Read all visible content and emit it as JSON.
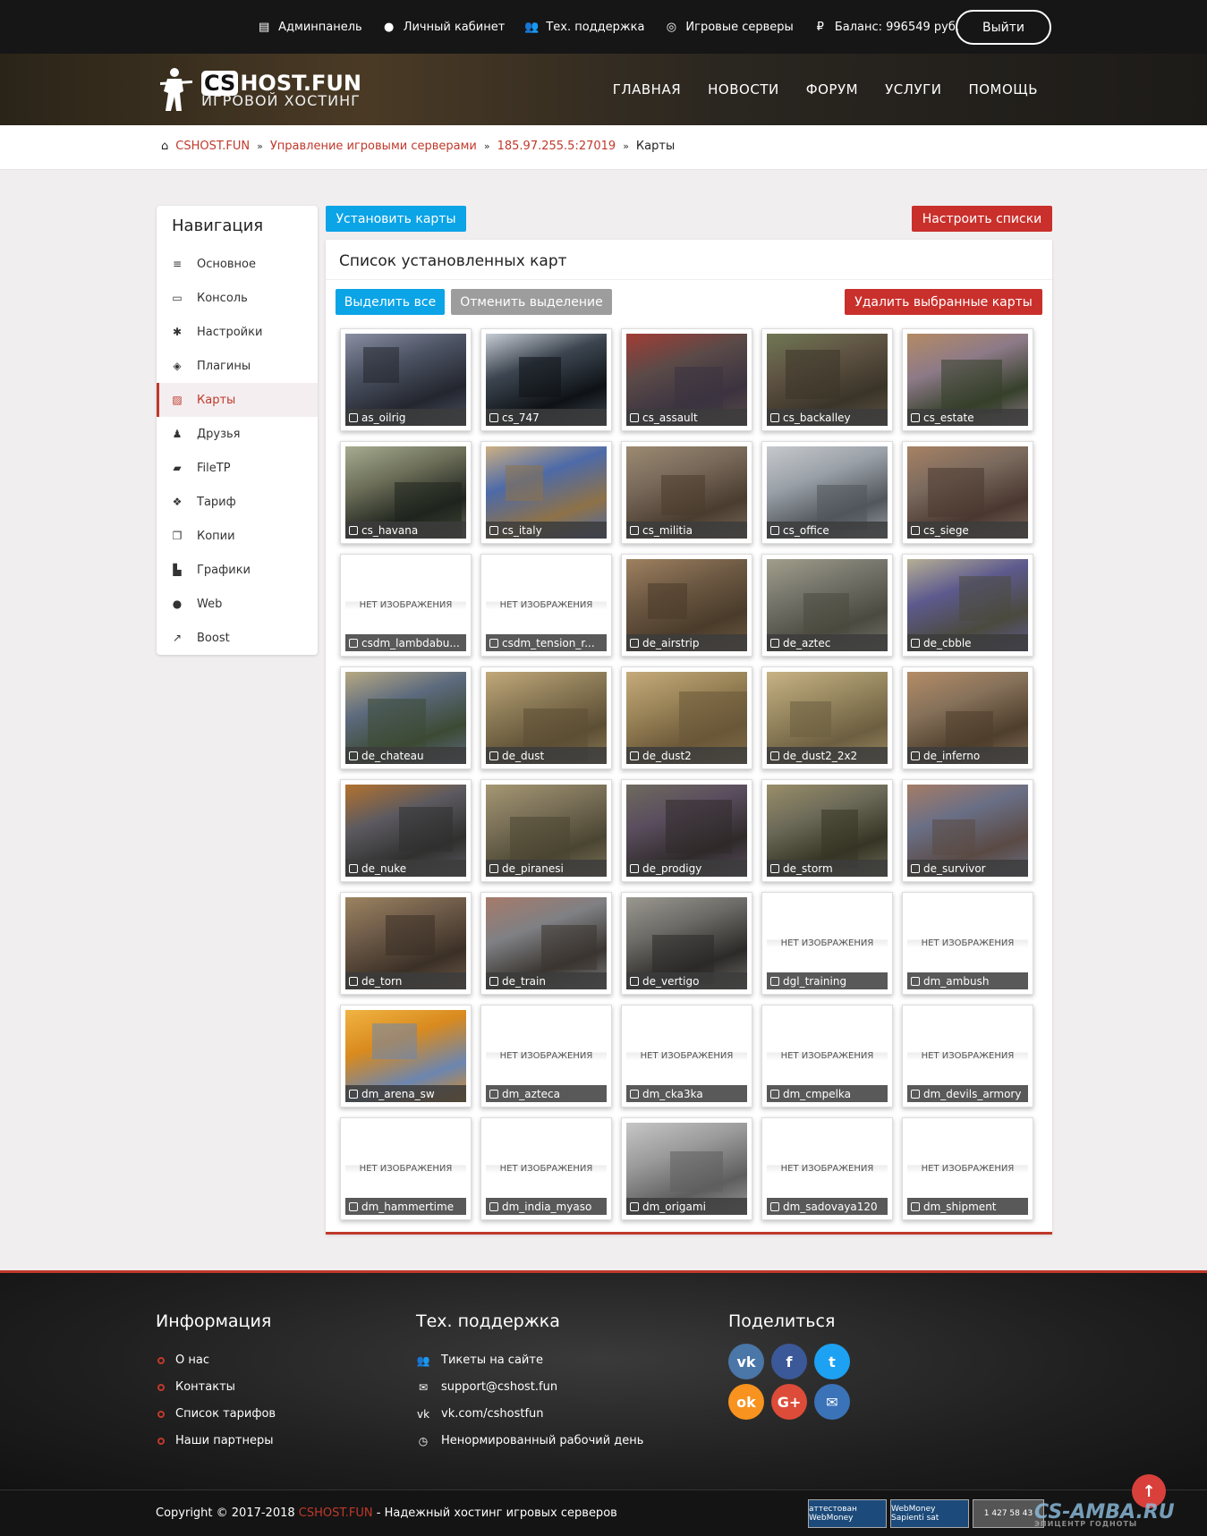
{
  "topbar": {
    "items": [
      {
        "icon": "admin-panel-icon",
        "label": "Админпанель"
      },
      {
        "icon": "user-icon",
        "label": "Личный кабинет"
      },
      {
        "icon": "support-users-icon",
        "label": "Тех. поддержка"
      },
      {
        "icon": "gamepad-icon",
        "label": "Игровые серверы"
      },
      {
        "icon": "ruble-icon",
        "label": "Баланс: 996549 руб."
      }
    ],
    "logout": "Выйти"
  },
  "logo": {
    "cs": "CS",
    "host": "HOST.FUN",
    "subtitle": "ИГРОВОЙ ХОСТИНГ"
  },
  "mainnav": [
    "ГЛАВНАЯ",
    "НОВОСТИ",
    "ФОРУМ",
    "УСЛУГИ",
    "ПОМОЩЬ"
  ],
  "breadcrumb": {
    "items": [
      "CSHOST.FUN",
      "Управление игровыми серверами",
      "185.97.255.5:27019"
    ],
    "current": "Карты"
  },
  "sidebar": {
    "title": "Навигация",
    "items": [
      {
        "icon": "list-icon",
        "label": "Основное"
      },
      {
        "icon": "monitor-icon",
        "label": "Консоль"
      },
      {
        "icon": "gear-icon",
        "label": "Настройки"
      },
      {
        "icon": "cubes-icon",
        "label": "Плагины"
      },
      {
        "icon": "image-icon",
        "label": "Карты",
        "active": true
      },
      {
        "icon": "user-plus-icon",
        "label": "Друзья"
      },
      {
        "icon": "folder-open-icon",
        "label": "FileTP"
      },
      {
        "icon": "dropbox-icon",
        "label": "Тариф"
      },
      {
        "icon": "copy-icon",
        "label": "Копии"
      },
      {
        "icon": "area-chart-icon",
        "label": "Графики"
      },
      {
        "icon": "globe-icon",
        "label": "Web"
      },
      {
        "icon": "line-chart-icon",
        "label": "Boost"
      }
    ]
  },
  "actions": {
    "install": "Установить карты",
    "configure": "Настроить списки"
  },
  "panel": {
    "title": "Список установленных карт",
    "select_all": "Выделить все",
    "deselect": "Отменить выделение",
    "delete_selected": "Удалить выбранные карты",
    "no_image": "НЕТ ИЗОБРАЖЕНИЯ"
  },
  "maps": [
    {
      "name": "as_oilrig",
      "img": true,
      "c1": "#4b5262",
      "c2": "#23262e",
      "c3": "#8a8fa3"
    },
    {
      "name": "cs_747",
      "img": true,
      "c1": "#3c4550",
      "c2": "#0e1216",
      "c3": "#c7ccd4"
    },
    {
      "name": "cs_assault",
      "img": true,
      "c1": "#5a4a48",
      "c2": "#3b3340",
      "c3": "#a23d35"
    },
    {
      "name": "cs_backalley",
      "img": true,
      "c1": "#5f5343",
      "c2": "#3a3428",
      "c3": "#6f7854"
    },
    {
      "name": "cs_estate",
      "img": true,
      "c1": "#8d7a88",
      "c2": "#35402a",
      "c3": "#b48a64"
    },
    {
      "name": "cs_havana",
      "img": true,
      "c1": "#6c6e58",
      "c2": "#1f241e",
      "c3": "#a6ab90"
    },
    {
      "name": "cs_italy",
      "img": true,
      "c1": "#4d6aa8",
      "c2": "#8e7248",
      "c3": "#cdb083"
    },
    {
      "name": "cs_militia",
      "img": true,
      "c1": "#77685a",
      "c2": "#4a3c2e",
      "c3": "#9c8a71"
    },
    {
      "name": "cs_office",
      "img": true,
      "c1": "#9aa0a8",
      "c2": "#51565b",
      "c3": "#c6c9cc"
    },
    {
      "name": "cs_siege",
      "img": true,
      "c1": "#7b6a5e",
      "c2": "#4a3830",
      "c3": "#a78264"
    },
    {
      "name": "csdm_lambdabu...",
      "img": false
    },
    {
      "name": "csdm_tension_r...",
      "img": false
    },
    {
      "name": "de_airstrip",
      "img": true,
      "c1": "#6e5a44",
      "c2": "#4a3b2a",
      "c3": "#9f8160"
    },
    {
      "name": "de_aztec",
      "img": true,
      "c1": "#74736a",
      "c2": "#4b4a40",
      "c3": "#a19e8a"
    },
    {
      "name": "de_cbble",
      "img": true,
      "c1": "#5d5a8e",
      "c2": "#4b4a3e",
      "c3": "#b6af95"
    },
    {
      "name": "de_chateau",
      "img": true,
      "c1": "#5c6a7e",
      "c2": "#3c4a34",
      "c3": "#b7a983"
    },
    {
      "name": "de_dust",
      "img": true,
      "c1": "#8b7a56",
      "c2": "#5c4e34",
      "c3": "#c2a87a"
    },
    {
      "name": "de_dust2",
      "img": true,
      "c1": "#9a8458",
      "c2": "#6a5738",
      "c3": "#c6ab7b"
    },
    {
      "name": "de_dust2_2x2",
      "img": true,
      "c1": "#9a8a62",
      "c2": "#6c5e40",
      "c3": "#c7b284"
    },
    {
      "name": "de_inferno",
      "img": true,
      "c1": "#86715a",
      "c2": "#4e3e2c",
      "c3": "#b48c66"
    },
    {
      "name": "de_nuke",
      "img": true,
      "c1": "#5c5a60",
      "c2": "#30302f",
      "c3": "#b3722e"
    },
    {
      "name": "de_piranesi",
      "img": true,
      "c1": "#7a7058",
      "c2": "#4a4532",
      "c3": "#a59772"
    },
    {
      "name": "de_prodigy",
      "img": true,
      "c1": "#5a4d5e",
      "c2": "#2f2a2a",
      "c3": "#6e6a5e"
    },
    {
      "name": "de_storm",
      "img": true,
      "c1": "#6c6a58",
      "c2": "#363424",
      "c3": "#9a8e6a"
    },
    {
      "name": "de_survivor",
      "img": true,
      "c1": "#6a6f86",
      "c2": "#5a4a44",
      "c3": "#a57c66"
    },
    {
      "name": "de_torn",
      "img": true,
      "c1": "#6d5a48",
      "c2": "#3b3026",
      "c3": "#9c8360"
    },
    {
      "name": "de_train",
      "img": true,
      "c1": "#7f8084",
      "c2": "#3a3530",
      "c3": "#a67a6a"
    },
    {
      "name": "de_vertigo",
      "img": true,
      "c1": "#6b6a66",
      "c2": "#2c2a28",
      "c3": "#9b9890"
    },
    {
      "name": "dgl_training",
      "img": false
    },
    {
      "name": "dm_ambush",
      "img": false
    },
    {
      "name": "dm_arena_sw",
      "img": true,
      "c1": "#d98a1e",
      "c2": "#6c86b0",
      "c3": "#f0b443"
    },
    {
      "name": "dm_azteca",
      "img": false
    },
    {
      "name": "dm_cka3ka",
      "img": false
    },
    {
      "name": "dm_cmpelka",
      "img": false
    },
    {
      "name": "dm_devils_armory",
      "img": false
    },
    {
      "name": "dm_hammertime",
      "img": false
    },
    {
      "name": "dm_india_myaso",
      "img": false
    },
    {
      "name": "dm_origami",
      "img": true,
      "c1": "#9a9a9a",
      "c2": "#5e5e5e",
      "c3": "#c6c6c6"
    },
    {
      "name": "dm_sadovaya120",
      "img": false
    },
    {
      "name": "dm_shipment",
      "img": false
    }
  ],
  "footer": {
    "info_title": "Информация",
    "info_items": [
      "О нас",
      "Контакты",
      "Список тарифов",
      "Наши партнеры"
    ],
    "support_title": "Тех. поддержка",
    "support_items": [
      {
        "icon": "users-icon",
        "label": "Тикеты на сайте"
      },
      {
        "icon": "envelope-icon",
        "label": "support@cshost.fun"
      },
      {
        "icon": "vk-icon",
        "label": "vk.com/cshostfun"
      },
      {
        "icon": "clock-icon",
        "label": "Ненормированный рабочий день"
      }
    ],
    "share_title": "Поделиться",
    "social": [
      {
        "icon": "vk-icon",
        "color": "#4a76a8",
        "glyph": "vk"
      },
      {
        "icon": "facebook-icon",
        "color": "#3b5998",
        "glyph": "f"
      },
      {
        "icon": "twitter-icon",
        "color": "#1da1f2",
        "glyph": "t"
      },
      {
        "icon": "odnoklassniki-icon",
        "color": "#f7931e",
        "glyph": "ok"
      },
      {
        "icon": "google-plus-icon",
        "color": "#dd4b39",
        "glyph": "G+"
      },
      {
        "icon": "email-icon",
        "color": "#3b73b9",
        "glyph": "✉"
      }
    ],
    "copyright_prefix": "Copyright © 2017-2018 ",
    "copyright_brand": "CSHOST.FUN",
    "copyright_suffix": " - Надежный хостинг игровых серверов",
    "badges": [
      "аттестован WebMoney",
      "WebMoney Sapienti sat",
      "1 427 58 43"
    ],
    "watermark": "CS-AMBA.RU",
    "watermark_sub": "ЭПИЦЕНТР ГОДНОТЫ"
  }
}
